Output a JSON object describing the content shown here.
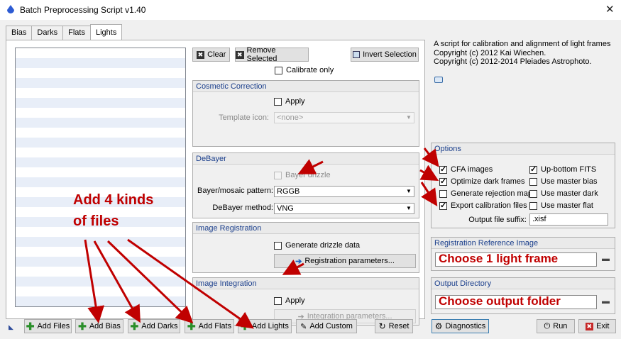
{
  "window": {
    "title": "Batch Preprocessing Script v1.40",
    "close_icon": "close-icon"
  },
  "tabs": [
    "Bias",
    "Darks",
    "Flats",
    "Lights"
  ],
  "list_buttons": {
    "clear": "Clear",
    "remove_selected": "Remove Selected",
    "invert_selection": "Invert Selection",
    "calibrate_only": "Calibrate only"
  },
  "cosmetic": {
    "header": "Cosmetic Correction",
    "apply": "Apply",
    "template_label": "Template icon:",
    "template_value": "<none>"
  },
  "debayer": {
    "header": "DeBayer",
    "bayer_drizzle": "Bayer drizzle",
    "pattern_label": "Bayer/mosaic pattern:",
    "pattern_value": "RGGB",
    "method_label": "DeBayer method:",
    "method_value": "VNG"
  },
  "registration": {
    "header": "Image Registration",
    "generate_drizzle": "Generate drizzle data",
    "params_button": "Registration parameters..."
  },
  "integration": {
    "header": "Image Integration",
    "apply": "Apply",
    "params_button": "Integration parameters..."
  },
  "info": {
    "line1": "A script for calibration and alignment of light frames",
    "line2": "Copyright (c) 2012 Kai Wiechen.",
    "line3": "Copyright (c) 2012-2014 Pleiades Astrophoto."
  },
  "options": {
    "header": "Options",
    "cfa_images": "CFA images",
    "optimize_dark": "Optimize dark frames",
    "generate_rejection": "Generate rejection maps",
    "export_calibration": "Export calibration files",
    "up_bottom": "Up-bottom FITS",
    "use_master_bias": "Use master bias",
    "use_master_dark": "Use master dark",
    "use_master_flat": "Use master flat",
    "suffix_label": "Output file suffix:",
    "suffix_value": ".xisf"
  },
  "reference": {
    "header": "Registration Reference Image",
    "value": "Choose 1 light frame"
  },
  "output_dir": {
    "header": "Output Directory",
    "value": "Choose output folder"
  },
  "annotation": {
    "line1": "Add 4 kinds",
    "line2": "of files"
  },
  "bottom": {
    "add_files": "Add Files",
    "add_bias": "Add Bias",
    "add_darks": "Add Darks",
    "add_flats": "Add Flats",
    "add_lights": "Add Lights",
    "add_custom": "Add Custom",
    "reset": "Reset",
    "diagnostics": "Diagnostics",
    "run": "Run",
    "exit": "Exit"
  },
  "colors": {
    "accent": "#1b3f8c",
    "annotation": "#c00000",
    "add_icon": "#2a8f2a"
  }
}
